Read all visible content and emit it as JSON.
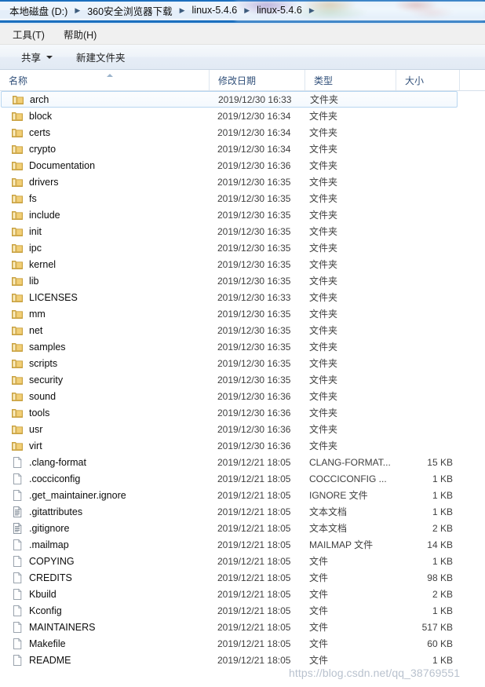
{
  "window": {
    "breadcrumb": {
      "separator": "▶",
      "crumbs": [
        "本地磁盘 (D:)",
        "360安全浏览器下载",
        "linux-5.4.6",
        "linux-5.4.6"
      ]
    },
    "menubar": [
      "工具(T)",
      "帮助(H)"
    ],
    "toolbar": {
      "share_label": "共享",
      "new_folder_label": "新建文件夹"
    }
  },
  "columns": {
    "name": "名称",
    "date_modified": "修改日期",
    "type": "类型",
    "size": "大小"
  },
  "colors": {
    "accent_blue": "#1b6fbe",
    "header_text": "#31507a",
    "folder_yellow": "#f4cf6a",
    "hover_border": "#b8d6f0",
    "watermark": "#b9c2ce"
  },
  "icons": {
    "folder": "folder-icon",
    "file": "file-icon",
    "text": "text-document-icon",
    "sort_asc": "sort-ascending-icon",
    "dropdown": "chevron-down-icon"
  },
  "rows": [
    {
      "name": "arch",
      "date": "2019/12/30 16:33",
      "type": "文件夹",
      "size": "",
      "icon": "folder",
      "hovered": true
    },
    {
      "name": "block",
      "date": "2019/12/30 16:34",
      "type": "文件夹",
      "size": "",
      "icon": "folder",
      "hovered": false
    },
    {
      "name": "certs",
      "date": "2019/12/30 16:34",
      "type": "文件夹",
      "size": "",
      "icon": "folder",
      "hovered": false
    },
    {
      "name": "crypto",
      "date": "2019/12/30 16:34",
      "type": "文件夹",
      "size": "",
      "icon": "folder",
      "hovered": false
    },
    {
      "name": "Documentation",
      "date": "2019/12/30 16:36",
      "type": "文件夹",
      "size": "",
      "icon": "folder",
      "hovered": false
    },
    {
      "name": "drivers",
      "date": "2019/12/30 16:35",
      "type": "文件夹",
      "size": "",
      "icon": "folder",
      "hovered": false
    },
    {
      "name": "fs",
      "date": "2019/12/30 16:35",
      "type": "文件夹",
      "size": "",
      "icon": "folder",
      "hovered": false
    },
    {
      "name": "include",
      "date": "2019/12/30 16:35",
      "type": "文件夹",
      "size": "",
      "icon": "folder",
      "hovered": false
    },
    {
      "name": "init",
      "date": "2019/12/30 16:35",
      "type": "文件夹",
      "size": "",
      "icon": "folder",
      "hovered": false
    },
    {
      "name": "ipc",
      "date": "2019/12/30 16:35",
      "type": "文件夹",
      "size": "",
      "icon": "folder",
      "hovered": false
    },
    {
      "name": "kernel",
      "date": "2019/12/30 16:35",
      "type": "文件夹",
      "size": "",
      "icon": "folder",
      "hovered": false
    },
    {
      "name": "lib",
      "date": "2019/12/30 16:35",
      "type": "文件夹",
      "size": "",
      "icon": "folder",
      "hovered": false
    },
    {
      "name": "LICENSES",
      "date": "2019/12/30 16:33",
      "type": "文件夹",
      "size": "",
      "icon": "folder",
      "hovered": false
    },
    {
      "name": "mm",
      "date": "2019/12/30 16:35",
      "type": "文件夹",
      "size": "",
      "icon": "folder",
      "hovered": false
    },
    {
      "name": "net",
      "date": "2019/12/30 16:35",
      "type": "文件夹",
      "size": "",
      "icon": "folder",
      "hovered": false
    },
    {
      "name": "samples",
      "date": "2019/12/30 16:35",
      "type": "文件夹",
      "size": "",
      "icon": "folder",
      "hovered": false
    },
    {
      "name": "scripts",
      "date": "2019/12/30 16:35",
      "type": "文件夹",
      "size": "",
      "icon": "folder",
      "hovered": false
    },
    {
      "name": "security",
      "date": "2019/12/30 16:35",
      "type": "文件夹",
      "size": "",
      "icon": "folder",
      "hovered": false
    },
    {
      "name": "sound",
      "date": "2019/12/30 16:36",
      "type": "文件夹",
      "size": "",
      "icon": "folder",
      "hovered": false
    },
    {
      "name": "tools",
      "date": "2019/12/30 16:36",
      "type": "文件夹",
      "size": "",
      "icon": "folder",
      "hovered": false
    },
    {
      "name": "usr",
      "date": "2019/12/30 16:36",
      "type": "文件夹",
      "size": "",
      "icon": "folder",
      "hovered": false
    },
    {
      "name": "virt",
      "date": "2019/12/30 16:36",
      "type": "文件夹",
      "size": "",
      "icon": "folder",
      "hovered": false
    },
    {
      "name": ".clang-format",
      "date": "2019/12/21 18:05",
      "type": "CLANG-FORMAT...",
      "size": "15 KB",
      "icon": "file",
      "hovered": false
    },
    {
      "name": ".cocciconfig",
      "date": "2019/12/21 18:05",
      "type": "COCCICONFIG ...",
      "size": "1 KB",
      "icon": "file",
      "hovered": false
    },
    {
      "name": ".get_maintainer.ignore",
      "date": "2019/12/21 18:05",
      "type": "IGNORE 文件",
      "size": "1 KB",
      "icon": "file",
      "hovered": false
    },
    {
      "name": ".gitattributes",
      "date": "2019/12/21 18:05",
      "type": "文本文档",
      "size": "1 KB",
      "icon": "text",
      "hovered": false
    },
    {
      "name": ".gitignore",
      "date": "2019/12/21 18:05",
      "type": "文本文档",
      "size": "2 KB",
      "icon": "text",
      "hovered": false
    },
    {
      "name": ".mailmap",
      "date": "2019/12/21 18:05",
      "type": "MAILMAP 文件",
      "size": "14 KB",
      "icon": "file",
      "hovered": false
    },
    {
      "name": "COPYING",
      "date": "2019/12/21 18:05",
      "type": "文件",
      "size": "1 KB",
      "icon": "file",
      "hovered": false
    },
    {
      "name": "CREDITS",
      "date": "2019/12/21 18:05",
      "type": "文件",
      "size": "98 KB",
      "icon": "file",
      "hovered": false
    },
    {
      "name": "Kbuild",
      "date": "2019/12/21 18:05",
      "type": "文件",
      "size": "2 KB",
      "icon": "file",
      "hovered": false
    },
    {
      "name": "Kconfig",
      "date": "2019/12/21 18:05",
      "type": "文件",
      "size": "1 KB",
      "icon": "file",
      "hovered": false
    },
    {
      "name": "MAINTAINERS",
      "date": "2019/12/21 18:05",
      "type": "文件",
      "size": "517 KB",
      "icon": "file",
      "hovered": false
    },
    {
      "name": "Makefile",
      "date": "2019/12/21 18:05",
      "type": "文件",
      "size": "60 KB",
      "icon": "file",
      "hovered": false
    },
    {
      "name": "README",
      "date": "2019/12/21 18:05",
      "type": "文件",
      "size": "1 KB",
      "icon": "file",
      "hovered": false
    }
  ],
  "watermark": "https://blog.csdn.net/qq_38769551"
}
